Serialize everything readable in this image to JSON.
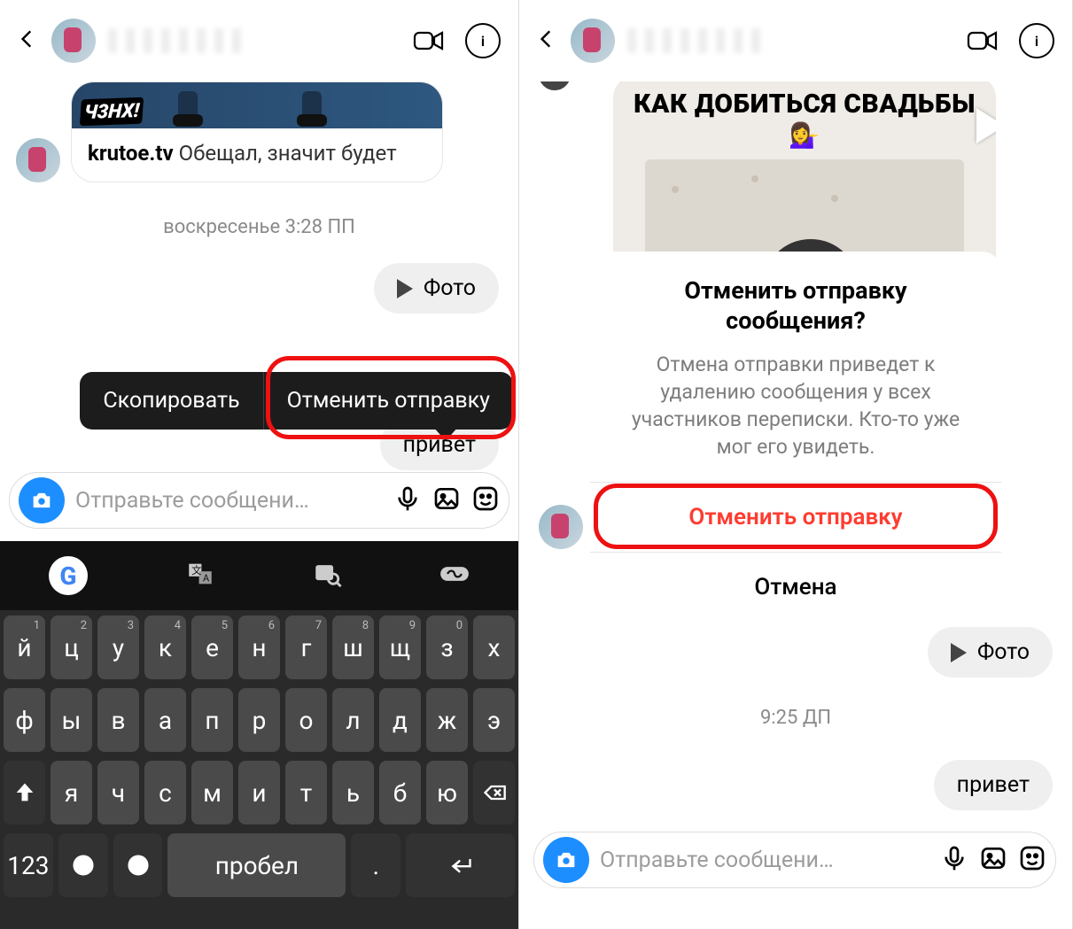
{
  "left": {
    "shared": {
      "badge": "Ч3НХ!",
      "author": "krutoe.tv",
      "caption": "Обещал, значит будет"
    },
    "timestamp": "воскресенье 3:28 ПП",
    "photo_label": "Фото",
    "context_menu": {
      "copy": "Скопировать",
      "unsend": "Отменить отправку"
    },
    "message": "привет",
    "input_placeholder": "Отправьте сообщени…",
    "keyboard": {
      "row1": [
        {
          "k": "й",
          "h": "1"
        },
        {
          "k": "ц",
          "h": "2"
        },
        {
          "k": "у",
          "h": "3"
        },
        {
          "k": "к",
          "h": "4"
        },
        {
          "k": "е",
          "h": "5"
        },
        {
          "k": "н",
          "h": "6"
        },
        {
          "k": "г",
          "h": "7"
        },
        {
          "k": "ш",
          "h": "8"
        },
        {
          "k": "щ",
          "h": "9"
        },
        {
          "k": "з",
          "h": "0"
        },
        {
          "k": "х",
          "h": ""
        }
      ],
      "row2": [
        {
          "k": "ф"
        },
        {
          "k": "ы"
        },
        {
          "k": "в"
        },
        {
          "k": "а"
        },
        {
          "k": "п"
        },
        {
          "k": "р"
        },
        {
          "k": "о"
        },
        {
          "k": "л"
        },
        {
          "k": "д"
        },
        {
          "k": "ж"
        },
        {
          "k": "э"
        }
      ],
      "row3_mid": [
        {
          "k": "я"
        },
        {
          "k": "ч"
        },
        {
          "k": "с"
        },
        {
          "k": "м"
        },
        {
          "k": "и"
        },
        {
          "k": "т"
        },
        {
          "k": "ь"
        },
        {
          "k": "б"
        },
        {
          "k": "ю"
        }
      ],
      "row4": {
        "num": "123",
        "space": "пробел"
      }
    }
  },
  "right": {
    "reel_title": "КАК ДОБИТЬСЯ СВАДЬБЫ",
    "reel_emoji": "💁‍♀️",
    "modal": {
      "title": "Отменить отправку сообщения?",
      "body": "Отмена отправки приведет к удалению сообщения у всех участников переписки. Кто-то уже мог его увидеть.",
      "confirm": "Отменить отправку",
      "cancel": "Отмена"
    },
    "photo_label": "Фото",
    "timestamp": "9:25 ДП",
    "message": "привет",
    "input_placeholder": "Отправьте сообщени…"
  }
}
